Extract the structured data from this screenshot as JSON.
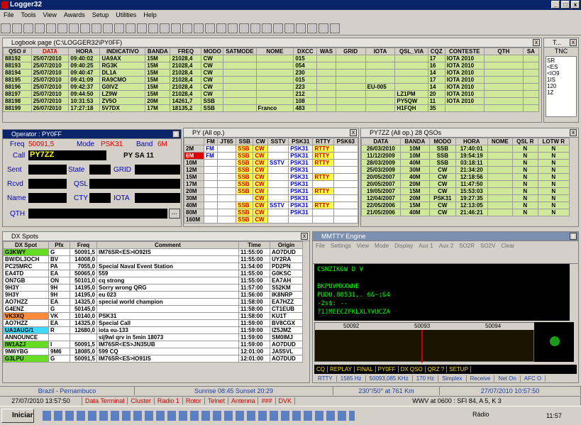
{
  "app": {
    "title": "Logger32",
    "menu": [
      "File",
      "Tools",
      "View",
      "Awards",
      "Setup",
      "Utilities",
      "Help"
    ]
  },
  "logbook": {
    "title": "Logbook page (C:\\LOGGER32\\PY0FF)",
    "headers": [
      "QSO #",
      "DATA",
      "HORA",
      "INDICATIVO",
      "BANDA",
      "FREQ",
      "MODO",
      "SATMODE",
      "NOME",
      "DXCC",
      "WAS",
      "GRID",
      "IOTA",
      "QSL_VIA",
      "CQZ",
      "CONTESTE",
      "QTH",
      "SA"
    ],
    "rows": [
      [
        "88192",
        "25/07/2010",
        "09:40:02",
        "UA9AX",
        "15M",
        "21028,4",
        "CW",
        "",
        "",
        "015",
        "",
        "",
        "",
        "",
        "17",
        "IOTA 2010",
        "",
        ""
      ],
      [
        "88193",
        "25/07/2010",
        "09:40:25",
        "RG3K",
        "15M",
        "21028,4",
        "CW",
        "",
        "",
        "054",
        "",
        "",
        "",
        "",
        "16",
        "IOTA 2010",
        "",
        ""
      ],
      [
        "88194",
        "25/07/2010",
        "09:40:47",
        "DL1A",
        "15M",
        "21028,4",
        "CW",
        "",
        "",
        "230",
        "",
        "",
        "",
        "",
        "14",
        "IOTA 2010",
        "",
        ""
      ],
      [
        "88195",
        "25/07/2010",
        "09:41:09",
        "RA9CMO",
        "15M",
        "21028,4",
        "CW",
        "",
        "",
        "015",
        "",
        "",
        "",
        "",
        "17",
        "IOTA 2010",
        "",
        ""
      ],
      [
        "88196",
        "25/07/2010",
        "09:42:37",
        "G0IVZ",
        "15M",
        "21028,4",
        "CW",
        "",
        "",
        "223",
        "",
        "",
        "EU-005",
        "",
        "14",
        "IOTA 2010",
        "",
        ""
      ],
      [
        "88197",
        "25/07/2010",
        "09:44:50",
        "LZ9W",
        "15M",
        "21028,4",
        "CW",
        "",
        "",
        "212",
        "",
        "",
        "",
        "LZ1PM",
        "20",
        "IOTA 2010",
        "",
        ""
      ],
      [
        "88198",
        "25/07/2010",
        "10:31:53",
        "ZV5O",
        "20M",
        "14261,7",
        "SSB",
        "",
        "",
        "108",
        "",
        "",
        "",
        "PY5QW",
        "11",
        "IOTA 2010",
        "",
        ""
      ],
      [
        "88199",
        "26/07/2010",
        "17:27:18",
        "5V7DX",
        "17M",
        "18135,2",
        "SSB",
        "",
        "Franco",
        "483",
        "",
        "",
        "",
        "H1FQH",
        "35",
        "",
        "",
        ""
      ]
    ]
  },
  "tnc": {
    "title": "T...",
    "label": "TNC",
    "items": [
      "SR",
      "<ES",
      "<IO9",
      "1IS",
      "120",
      "1Z"
    ]
  },
  "operator": {
    "title": "Operator : PY0FF",
    "freq_label": "Freq",
    "freq": "50091,5",
    "mode_label": "Mode",
    "mode": "PSK31",
    "band_label": "Band",
    "band": "6M",
    "call_label": "Call",
    "call": "PY7ZZ",
    "call_info": "PY SA 11",
    "sent": "Sent",
    "state": "State",
    "grid": "GRID",
    "rcvd": "Rcvd",
    "qsl": "QSL",
    "name": "Name",
    "cty": "CTY",
    "iota": "IOTA",
    "qth": "QTH",
    "more": "..."
  },
  "bands": {
    "title": "PY (All op.)",
    "headers": [
      "",
      "FM",
      "JT65",
      "SSB",
      "CW",
      "SSTV",
      "PSK31",
      "RTTY",
      "PSK63"
    ],
    "rows": [
      [
        "2M",
        "FM",
        "",
        "SSB",
        "CW",
        "",
        "PSK31",
        "RTTY",
        ""
      ],
      [
        "6M",
        "FM",
        "",
        "SSB",
        "CW",
        "",
        "PSK31",
        "RTTY",
        ""
      ],
      [
        "10M",
        "",
        "",
        "SSB",
        "CW",
        "SSTV",
        "PSK31",
        "RTTY",
        ""
      ],
      [
        "12M",
        "",
        "",
        "SSB",
        "CW",
        "",
        "PSK31",
        "",
        ""
      ],
      [
        "15M",
        "",
        "",
        "SSB",
        "CW",
        "",
        "PSK31",
        "RTTY",
        ""
      ],
      [
        "17M",
        "",
        "",
        "SSB",
        "CW",
        "",
        "PSK31",
        "",
        ""
      ],
      [
        "20M",
        "",
        "",
        "SSB",
        "CW",
        "",
        "PSK31",
        "RTTY",
        ""
      ],
      [
        "30M",
        "",
        "",
        "",
        "CW",
        "",
        "PSK31",
        "",
        ""
      ],
      [
        "40M",
        "",
        "",
        "SSB",
        "CW",
        "SSTV",
        "PSK31",
        "RTTY",
        ""
      ],
      [
        "80M",
        "",
        "",
        "SSB",
        "CW",
        "",
        "PSK31",
        "",
        ""
      ],
      [
        "160M",
        "",
        "",
        "SSB",
        "CW",
        "",
        "",
        "",
        ""
      ]
    ]
  },
  "prev": {
    "title": "PY7ZZ (All op.)   28 QSOs",
    "headers": [
      "DATA",
      "BANDA",
      "MODO",
      "HORA",
      "NOME",
      "QSL R",
      "LOTW R"
    ],
    "rows": [
      [
        "26/03/2010",
        "10M",
        "SSB",
        "17:40:01",
        "",
        "N",
        "N"
      ],
      [
        "11/12/2009",
        "10M",
        "SSB",
        "19:54:19",
        "",
        "N",
        "N"
      ],
      [
        "28/03/2009",
        "40M",
        "SSB",
        "03:18:11",
        "",
        "N",
        "N"
      ],
      [
        "25/03/2009",
        "30M",
        "CW",
        "21:34:20",
        "",
        "N",
        "N"
      ],
      [
        "20/05/2007",
        "40M",
        "CW",
        "12:18:56",
        "",
        "N",
        "N"
      ],
      [
        "20/05/2007",
        "20M",
        "CW",
        "11:47:50",
        "",
        "N",
        "N"
      ],
      [
        "19/05/2007",
        "15M",
        "CW",
        "15:53:03",
        "",
        "N",
        "N"
      ],
      [
        "12/04/2007",
        "20M",
        "PSK31",
        "19:27:35",
        "",
        "N",
        "N"
      ],
      [
        "22/05/2006",
        "15M",
        "CW",
        "12:13:05",
        "",
        "N",
        "N"
      ],
      [
        "21/05/2006",
        "40M",
        "CW",
        "21:46:21",
        "",
        "N",
        "N"
      ]
    ]
  },
  "dx": {
    "title": "DX Spots",
    "headers": [
      "DX Spot",
      "Pfx",
      "Freq",
      "Comment",
      "Time",
      "Origin"
    ],
    "rows": [
      [
        "G3KWY",
        "G",
        "50091,5",
        "IM76SR<ES>IO92IS",
        "11:55:00",
        "AO7DUD",
        "g"
      ],
      [
        "BW/DL3OCH",
        "BV",
        "14008,0",
        "",
        "11:55:00",
        "UY2RA",
        "w"
      ],
      [
        "PC25MRC",
        "PA",
        "7055,0",
        "Special Naval Event Station",
        "11:54:00",
        "PD2PN",
        "w"
      ],
      [
        "EA4TD",
        "EA",
        "50065,0",
        "559",
        "11:55:00",
        "G0KSC",
        "w"
      ],
      [
        "ON7GB",
        "ON",
        "50101,0",
        "cq strong",
        "11:55:00",
        "EA7AH",
        "w"
      ],
      [
        "9H3Y",
        "9H",
        "14195,0",
        "Sorry wrong QRG",
        "11:57:00",
        "S52KM",
        "w"
      ],
      [
        "9H3Y",
        "9H",
        "14195,0",
        "eu 023",
        "11:56:00",
        "IK8NRP",
        "w"
      ],
      [
        "AO7HZZ",
        "EA",
        "14325,0",
        "special world champion",
        "11:58:00",
        "EA7HZZ",
        "w"
      ],
      [
        "G4ENZ",
        "G",
        "50145,0",
        "",
        "11:58:00",
        "CT1EUB",
        "w"
      ],
      [
        "VK3XQ",
        "VK",
        "10140,0",
        "PSK31",
        "11:58:00",
        "KU1T",
        "o"
      ],
      [
        "AO7HZZ",
        "EA",
        "14325,0",
        "Special Call",
        "11:59:00",
        "BV8CGX",
        "w"
      ],
      [
        "UA3AUG/1",
        "R",
        "12680,0",
        "iota eu-133",
        "11:59:00",
        "IZ5JMZ",
        "c"
      ],
      [
        "ANNOUNCE",
        "",
        "",
        "sij9wl qrv in 5min 18073",
        "11:59:00",
        "SM0IMJ",
        "w"
      ],
      [
        "IW1AZJ",
        "I",
        "50091,5",
        "IM76SR<ES>JN35UB",
        "11:59:00",
        "AO7DUD",
        "g"
      ],
      [
        "9M6YBG",
        "9M6",
        "18085,0",
        "599 CQ",
        "12:01:00",
        "JA5SVL",
        "w"
      ],
      [
        "G3LPU",
        "G",
        "50091,5",
        "IM76SR<ES>IO91IS",
        "12:01:00",
        "AO7DUD",
        "g"
      ]
    ]
  },
  "mmtty": {
    "title": "MMTTY Engine",
    "menu": [
      "File",
      "Settings",
      "View",
      "Mode",
      "Display",
      "Aux 1",
      "Aux 2",
      "SO2R",
      "SO2V",
      "Clear"
    ],
    "rx": [
      "CSNZIKGW D V",
      "",
      "BKPUVMXXWNE",
      "PUDU.88531,. 6&~;&4",
      "-2s$: --",
      "?1)MEECZFKLXLYVUCZA"
    ],
    "scale": [
      "50092",
      "50093",
      "50094"
    ],
    "macros": [
      "CQ",
      "REPLAY",
      "FINAL",
      "PY0FF",
      "DX QSO",
      "QRZ ?",
      "SETUP"
    ],
    "status": [
      "RTTY",
      "1585 Hz",
      "50093,085 KHz",
      "170 Hz",
      "Simplex",
      "Receive",
      "Net On",
      "AFC O"
    ]
  },
  "status1": {
    "left": "Brazil - Pernambuco",
    "sun": "Sunrise 08:45 Sunset 20:29",
    "bearing": "230°/50° at 761 Km",
    "date": "27/07/2010 10:57:50"
  },
  "status2": {
    "utc": "27/07/2010 13:57:50",
    "tabs": [
      "Data Terminal",
      "Cluster",
      "Radio 1",
      "Rotor",
      "Telnet",
      "Antenna",
      "###",
      "DVK"
    ],
    "wwv": "WWV at 0600 : SFI 84, A 5, K 3"
  },
  "taskbar": {
    "start": "Iniciar",
    "radio": "Rádio",
    "clock": "11:57"
  },
  "colors": {
    "logrow": "#cfe89a",
    "titlebar": "#0a246a"
  }
}
